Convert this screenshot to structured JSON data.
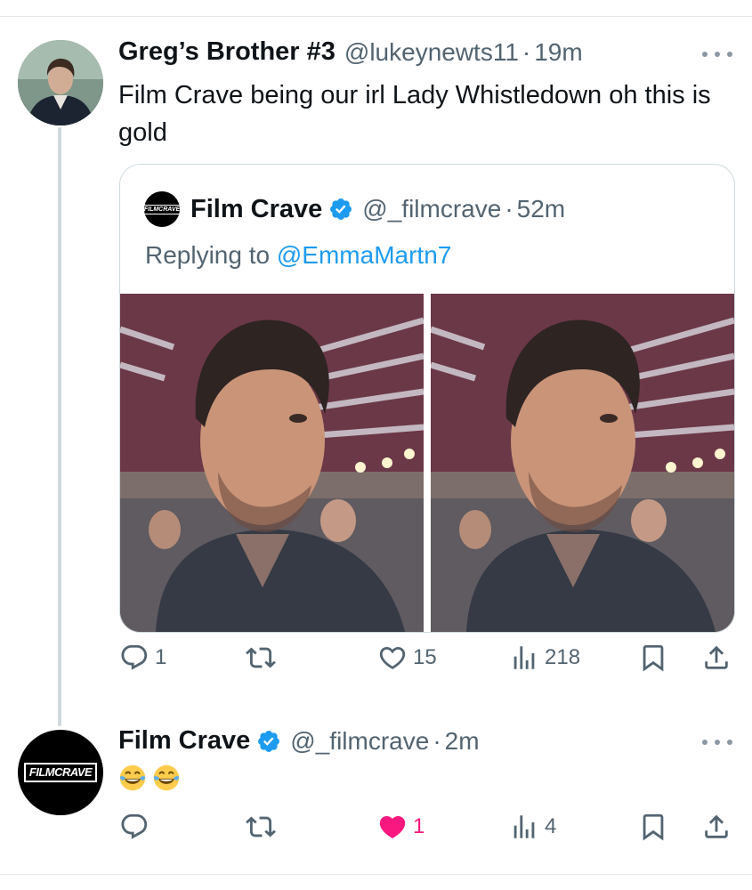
{
  "tweet1": {
    "author_name": "Greg’s Brother #3",
    "handle": "@lukeynewts11",
    "time": "19m",
    "text": "Film Crave being our irl Lady Whistledown oh this is gold",
    "quote": {
      "author_name": "Film Crave",
      "handle": "@_filmcrave",
      "time": "52m",
      "replying_prefix": "Replying to",
      "replying_handle": "@EmmaMartn7",
      "avatar_text": "FILMCRAVE",
      "image_count": 2
    },
    "actions": {
      "replies": "1",
      "retweets": "",
      "likes": "15",
      "views": "218"
    }
  },
  "tweet2": {
    "author_name": "Film Crave",
    "handle": "@_filmcrave",
    "time": "2m",
    "text_emoji": [
      "face-with-tears-of-joy",
      "face-with-tears-of-joy"
    ],
    "avatar_text": "FILMCRAVE",
    "actions": {
      "replies": "",
      "retweets": "",
      "likes": "1",
      "views": "4"
    },
    "liked": true
  },
  "separator_dot": "·",
  "colors": {
    "text": "#0f1419",
    "secondary": "#536471",
    "link": "#1d9bf0",
    "verified": "#1d9bf0",
    "like_active": "#f91880",
    "thread_line": "#cfd9de"
  },
  "icons": [
    "reply-icon",
    "retweet-icon",
    "like-icon",
    "views-icon",
    "bookmark-icon",
    "share-icon",
    "more-icon",
    "verified-badge-icon"
  ]
}
